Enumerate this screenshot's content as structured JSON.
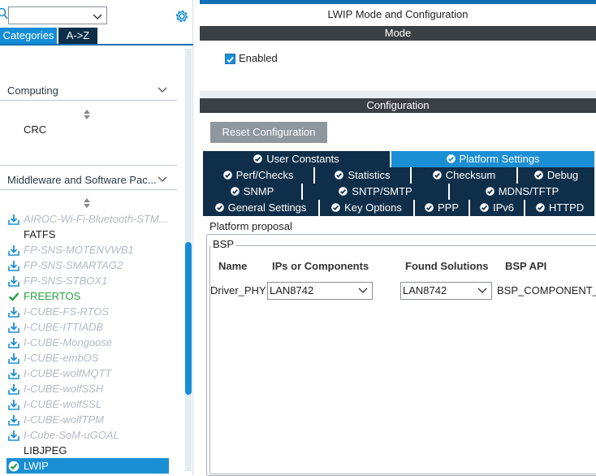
{
  "left_panel": {
    "search": {
      "value": ""
    },
    "tabs": {
      "categories": "Categories",
      "az": "A->Z"
    },
    "sections": {
      "computing": "Computing",
      "middleware": "Middleware and Software Pac..."
    },
    "computing_items": [
      "CRC"
    ],
    "middleware_items": [
      {
        "label": "AIROC-Wi-Fi-Bluetooth-STM...",
        "state": "disabled",
        "icon": "download-icon"
      },
      {
        "label": "FATFS",
        "state": "enabled",
        "icon": ""
      },
      {
        "label": "FP-SNS-MOTENVWB1",
        "state": "disabled",
        "icon": "download-icon"
      },
      {
        "label": "FP-SNS-SMARTAG2",
        "state": "disabled",
        "icon": "download-icon"
      },
      {
        "label": "FP-SNS-STBOX1",
        "state": "disabled",
        "icon": "download-icon"
      },
      {
        "label": "FREERTOS",
        "state": "green",
        "icon": "check-icon"
      },
      {
        "label": "I-CUBE-FS-RTOS",
        "state": "disabled",
        "icon": "download-icon"
      },
      {
        "label": "I-CUBE-ITTIADB",
        "state": "disabled",
        "icon": "download-icon"
      },
      {
        "label": "I-CUBE-Mongoose",
        "state": "disabled",
        "icon": "download-icon"
      },
      {
        "label": "I-CUBE-embOS",
        "state": "disabled",
        "icon": "download-icon"
      },
      {
        "label": "I-CUBE-wolfMQTT",
        "state": "disabled",
        "icon": "download-icon"
      },
      {
        "label": "I-CUBE-wolfSSH",
        "state": "disabled",
        "icon": "download-icon"
      },
      {
        "label": "I-CUBE-wolfSSL",
        "state": "disabled",
        "icon": "download-icon"
      },
      {
        "label": "I-CUBE-wolfTPM",
        "state": "disabled",
        "icon": "download-icon"
      },
      {
        "label": "I-Cube-SoM-uGOAL",
        "state": "disabled",
        "icon": "download-icon"
      },
      {
        "label": "LIBJPEG",
        "state": "enabled",
        "icon": ""
      },
      {
        "label": "LWIP",
        "state": "selected",
        "icon": "check-circle-icon"
      }
    ]
  },
  "right_panel": {
    "title": "LWIP Mode and Configuration",
    "mode_header": "Mode",
    "enabled_label": "Enabled",
    "config_header": "Configuration",
    "reset_button": "Reset Configuration",
    "param_tabs": [
      {
        "label": "User Constants",
        "active": false
      },
      {
        "label": "Platform Settings",
        "active": true
      },
      {
        "label": "Perf/Checks",
        "active": false
      },
      {
        "label": "Statistics",
        "active": false
      },
      {
        "label": "Checksum",
        "active": false
      },
      {
        "label": "Debug",
        "active": false
      },
      {
        "label": "SNMP",
        "active": false
      },
      {
        "label": "SNTP/SMTP",
        "active": false
      },
      {
        "label": "MDNS/TFTP",
        "active": false
      },
      {
        "label": "General Settings",
        "active": false
      },
      {
        "label": "Key Options",
        "active": false
      },
      {
        "label": "PPP",
        "active": false
      },
      {
        "label": "IPv6",
        "active": false
      },
      {
        "label": "HTTPD",
        "active": false
      }
    ],
    "platform_proposal_label": "Platform proposal",
    "bsp_label": "BSP",
    "table": {
      "headers": {
        "name": "Name",
        "ips": "IPs or Components",
        "found": "Found Solutions",
        "bsp_api": "BSP API"
      },
      "row": {
        "name": "Driver_PHY",
        "ips": "LAN8742",
        "found": "LAN8742",
        "bsp_api": "BSP_COMPONENT_"
      }
    }
  },
  "colors": {
    "accent": "#1b8fd4",
    "navy": "#0f2e4a",
    "header_dark": "#3b4045",
    "disabled_text": "#b2bac4",
    "green": "#26a045"
  }
}
